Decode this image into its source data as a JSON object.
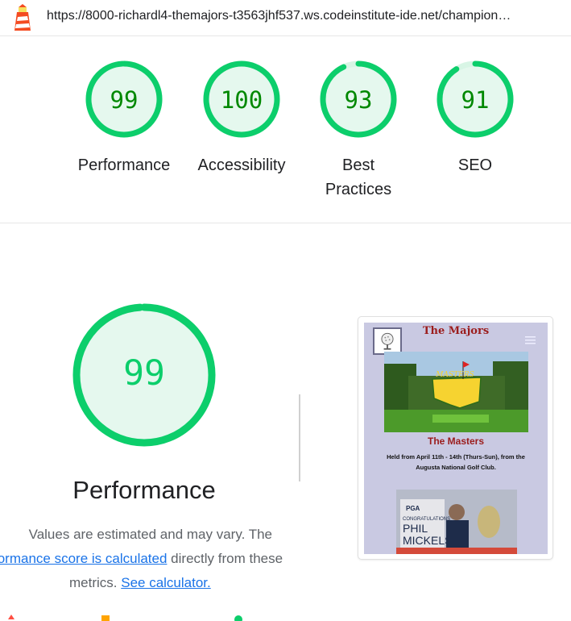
{
  "header": {
    "url": "https://8000-richardl4-themajors-t3563jhf537.ws.codeinstitute-ide.net/champion…",
    "logo_icon": "lighthouse-icon"
  },
  "gauges": [
    {
      "score": "99",
      "value": 99,
      "label": "Performance"
    },
    {
      "score": "100",
      "value": 100,
      "label": "Accessibility"
    },
    {
      "score": "93",
      "value": 93,
      "label_line1": "Best",
      "label_line2": "Practices"
    },
    {
      "score": "91",
      "value": 91,
      "label": "SEO"
    }
  ],
  "performance": {
    "score": "99",
    "value": 99,
    "title": "Performance",
    "desc_part1": "Values are estimated and may vary. The",
    "desc_link1": "formance score is calculated",
    "desc_part2": "directly from these",
    "desc_part3": "metrics.",
    "desc_link2": "See calculator."
  },
  "screenshot": {
    "site_title": "The Majors",
    "hero_caption": "The Masters",
    "hero_text": "Held from April 11th - 14th (Thurs-Sun), from the Augusta National Golf Club.",
    "hero_sign": "MASTERS",
    "photo_text1": "CONGRATULATIONS",
    "photo_text2": "PHIL",
    "photo_text3": "MICKELSON",
    "photo_badge": "PGA"
  },
  "colors": {
    "pass": "#0cce6b",
    "pass_text": "#008800",
    "pass_fill": "#e5f8ee",
    "track": "#d8f5e5"
  }
}
